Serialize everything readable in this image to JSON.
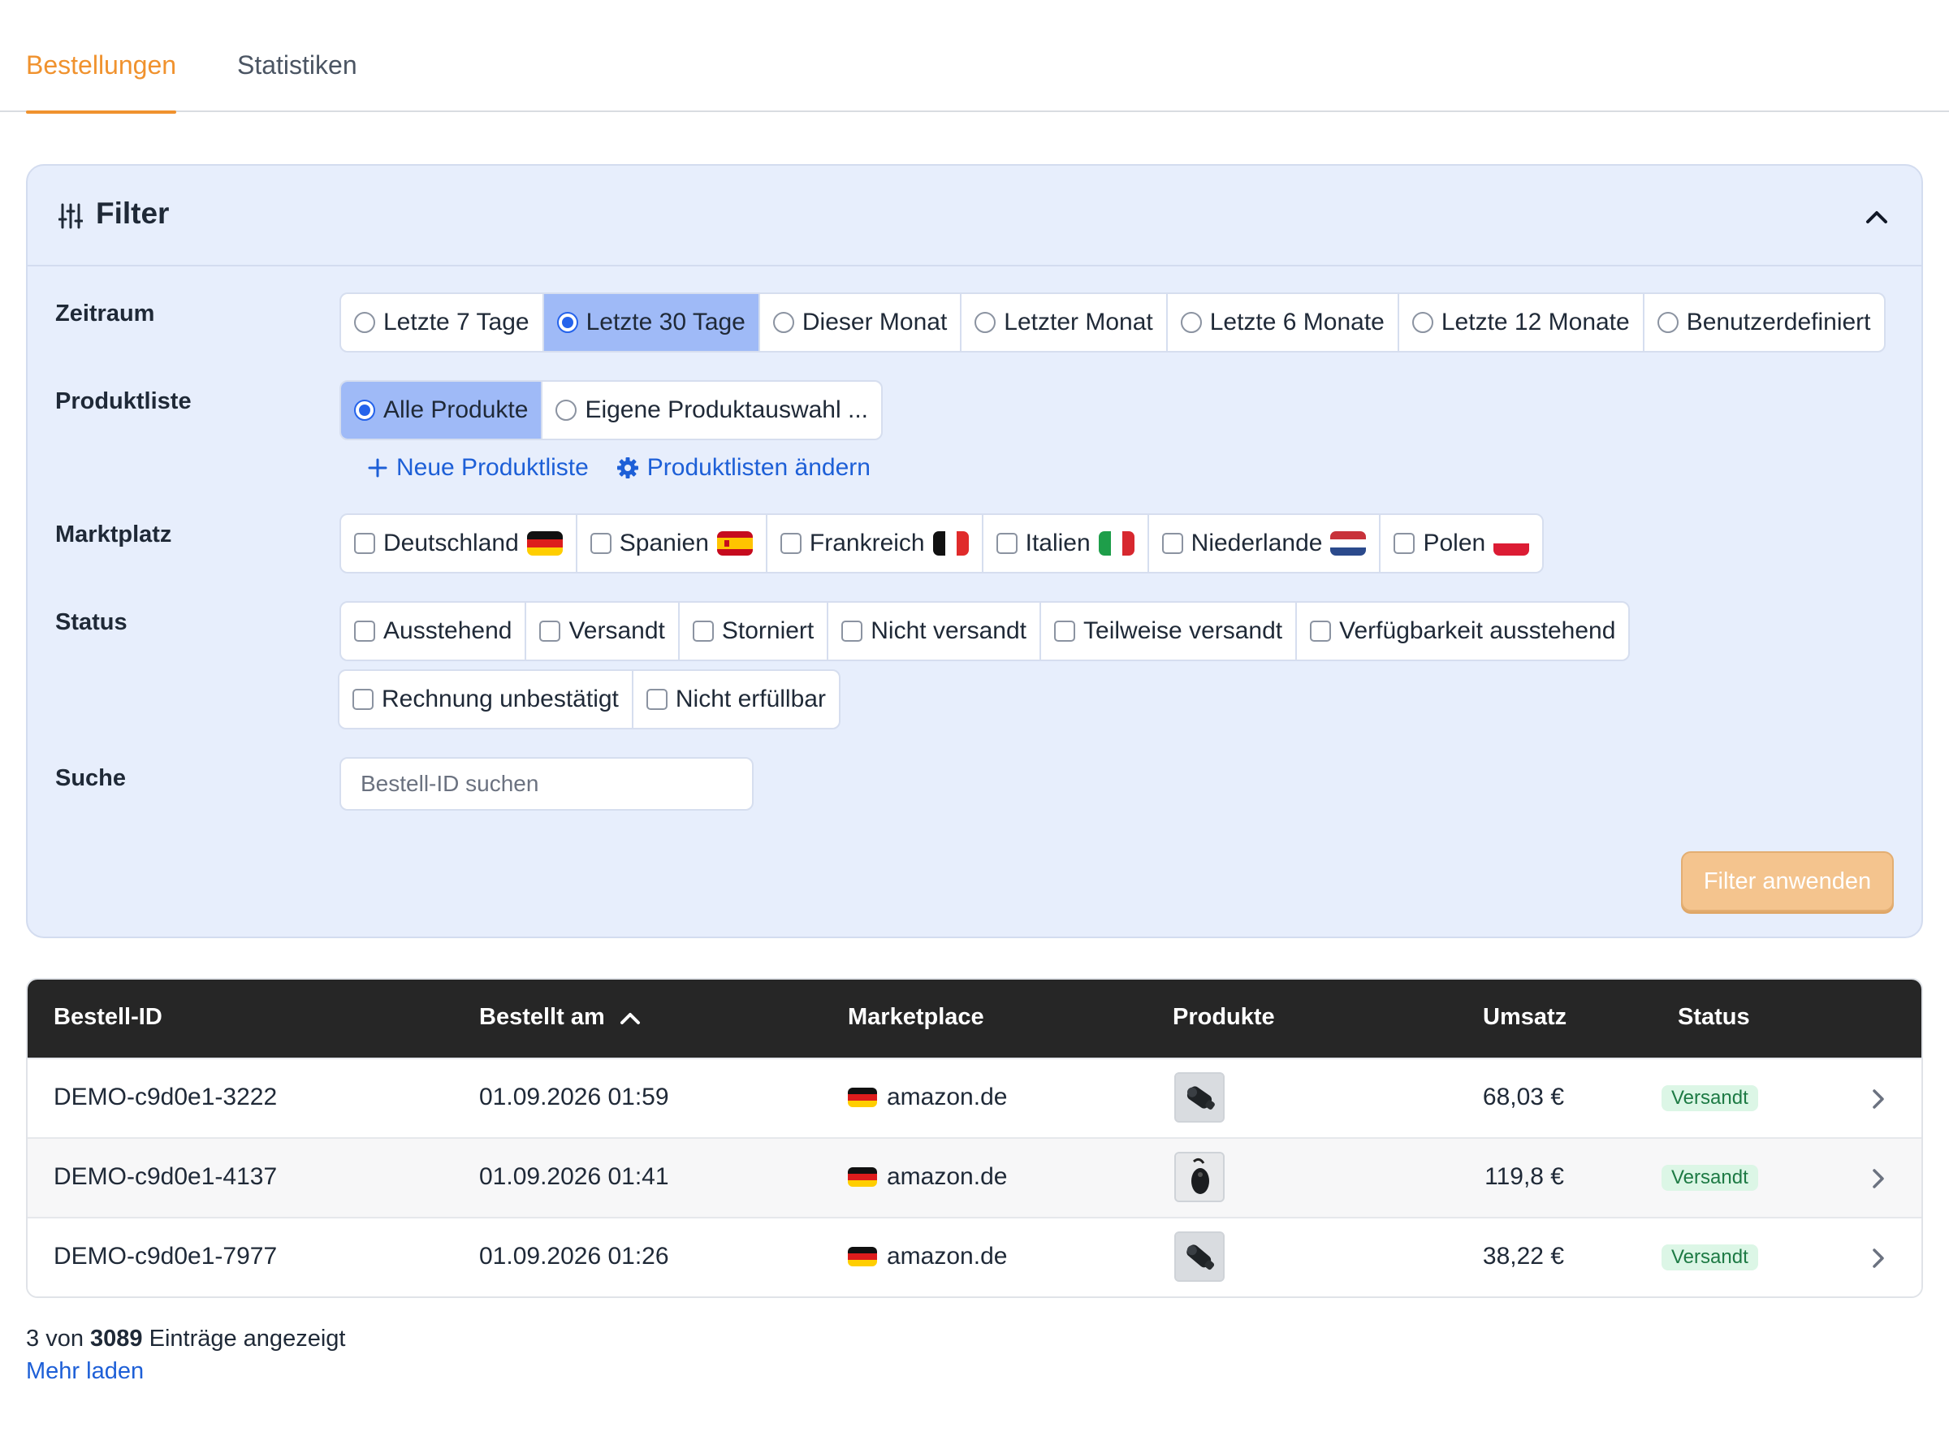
{
  "tabs": [
    {
      "label": "Bestellungen",
      "active": true
    },
    {
      "label": "Statistiken",
      "active": false
    }
  ],
  "filter": {
    "title": "Filter",
    "zeitraum": {
      "label": "Zeitraum",
      "options": [
        "Letzte 7 Tage",
        "Letzte 30 Tage",
        "Dieser Monat",
        "Letzter Monat",
        "Letzte 6 Monate",
        "Letzte 12 Monate",
        "Benutzerdefiniert"
      ],
      "selected": "Letzte 30 Tage"
    },
    "produktliste": {
      "label": "Produktliste",
      "options": [
        "Alle Produkte",
        "Eigene Produktauswahl ..."
      ],
      "selected": "Alle Produkte",
      "new_list": "Neue Produktliste",
      "edit_lists": "Produktlisten ändern"
    },
    "marktplatz": {
      "label": "Marktplatz",
      "options": [
        "Deutschland",
        "Spanien",
        "Frankreich",
        "Italien",
        "Niederlande",
        "Polen"
      ]
    },
    "status": {
      "label": "Status",
      "options": [
        "Ausstehend",
        "Versandt",
        "Storniert",
        "Nicht versandt",
        "Teilweise versandt",
        "Verfügbarkeit ausstehend",
        "Rechnung unbestätigt",
        "Nicht erfüllbar"
      ]
    },
    "suche": {
      "label": "Suche",
      "placeholder": "Bestell-ID suchen"
    },
    "apply": "Filter anwenden"
  },
  "table": {
    "columns": [
      "Bestell-ID",
      "Bestellt am",
      "Marketplace",
      "Produkte",
      "Umsatz",
      "Status"
    ],
    "rows": [
      {
        "id": "DEMO-c9d0e1-3222",
        "date": "01.09.2026 01:59",
        "marketplace": "amazon.de",
        "amount": "68,03 €",
        "status": "Versandt"
      },
      {
        "id": "DEMO-c9d0e1-4137",
        "date": "01.09.2026 01:41",
        "marketplace": "amazon.de",
        "amount": "119,8 €",
        "status": "Versandt"
      },
      {
        "id": "DEMO-c9d0e1-7977",
        "date": "01.09.2026 01:26",
        "marketplace": "amazon.de",
        "amount": "38,22 €",
        "status": "Versandt"
      }
    ]
  },
  "footer": {
    "shown": "3",
    "von": "von",
    "total": "3089",
    "suffix": "Einträge angezeigt",
    "more": "Mehr laden"
  },
  "colors": {
    "accent": "#f0922e",
    "link": "#1d5fd7",
    "panel": "#e7eefc",
    "selected": "#9fbaf7",
    "header": "#262626",
    "badge_bg": "#dcf6e6",
    "badge_fg": "#1d7a44"
  }
}
